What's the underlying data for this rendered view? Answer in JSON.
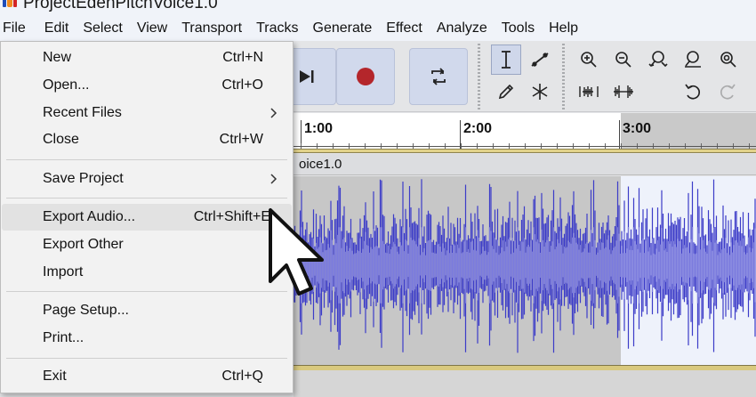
{
  "window": {
    "title": "ProjectEdenPitchVoice1.0"
  },
  "menubar": [
    "File",
    "Edit",
    "Select",
    "View",
    "Transport",
    "Tracks",
    "Generate",
    "Effect",
    "Analyze",
    "Tools",
    "Help"
  ],
  "transport": {
    "buttons": [
      "skip-end-icon",
      "record-icon",
      "loop-icon"
    ],
    "record_color": "#b4262b"
  },
  "tools": [
    "selection-tool-icon",
    "envelope-tool-icon",
    "draw-tool-icon",
    "multi-tool-icon"
  ],
  "edit_tools": [
    "zoom-in-icon",
    "zoom-out-icon",
    "fit-selection-icon",
    "fit-project-icon",
    "zoom-toggle-icon",
    "trim-audio-icon",
    "silence-audio-icon",
    "undo-icon",
    "redo-icon"
  ],
  "timeline": {
    "labels": [
      "1:00",
      "2:00",
      "3:00"
    ]
  },
  "track": {
    "name": "oice1.0",
    "wave_color": "#3c3cc8",
    "wave_light_color": "#7b7bde"
  },
  "file_menu": {
    "items": [
      {
        "label": "New",
        "shortcut": "Ctrl+N"
      },
      {
        "label": "Open...",
        "shortcut": "Ctrl+O"
      },
      {
        "label": "Recent Files",
        "shortcut": "",
        "submenu": true
      },
      {
        "label": "Close",
        "shortcut": "Ctrl+W"
      },
      {
        "label": "Save Project",
        "shortcut": "",
        "submenu": true
      },
      {
        "label": "Export Audio...",
        "shortcut": "Ctrl+Shift+E",
        "highlighted": true
      },
      {
        "label": "Export Other",
        "shortcut": "",
        "submenu": true
      },
      {
        "label": "Import",
        "shortcut": "",
        "submenu": true
      },
      {
        "label": "Page Setup...",
        "shortcut": ""
      },
      {
        "label": "Print...",
        "shortcut": ""
      },
      {
        "label": "Exit",
        "shortcut": "Ctrl+Q"
      }
    ]
  }
}
